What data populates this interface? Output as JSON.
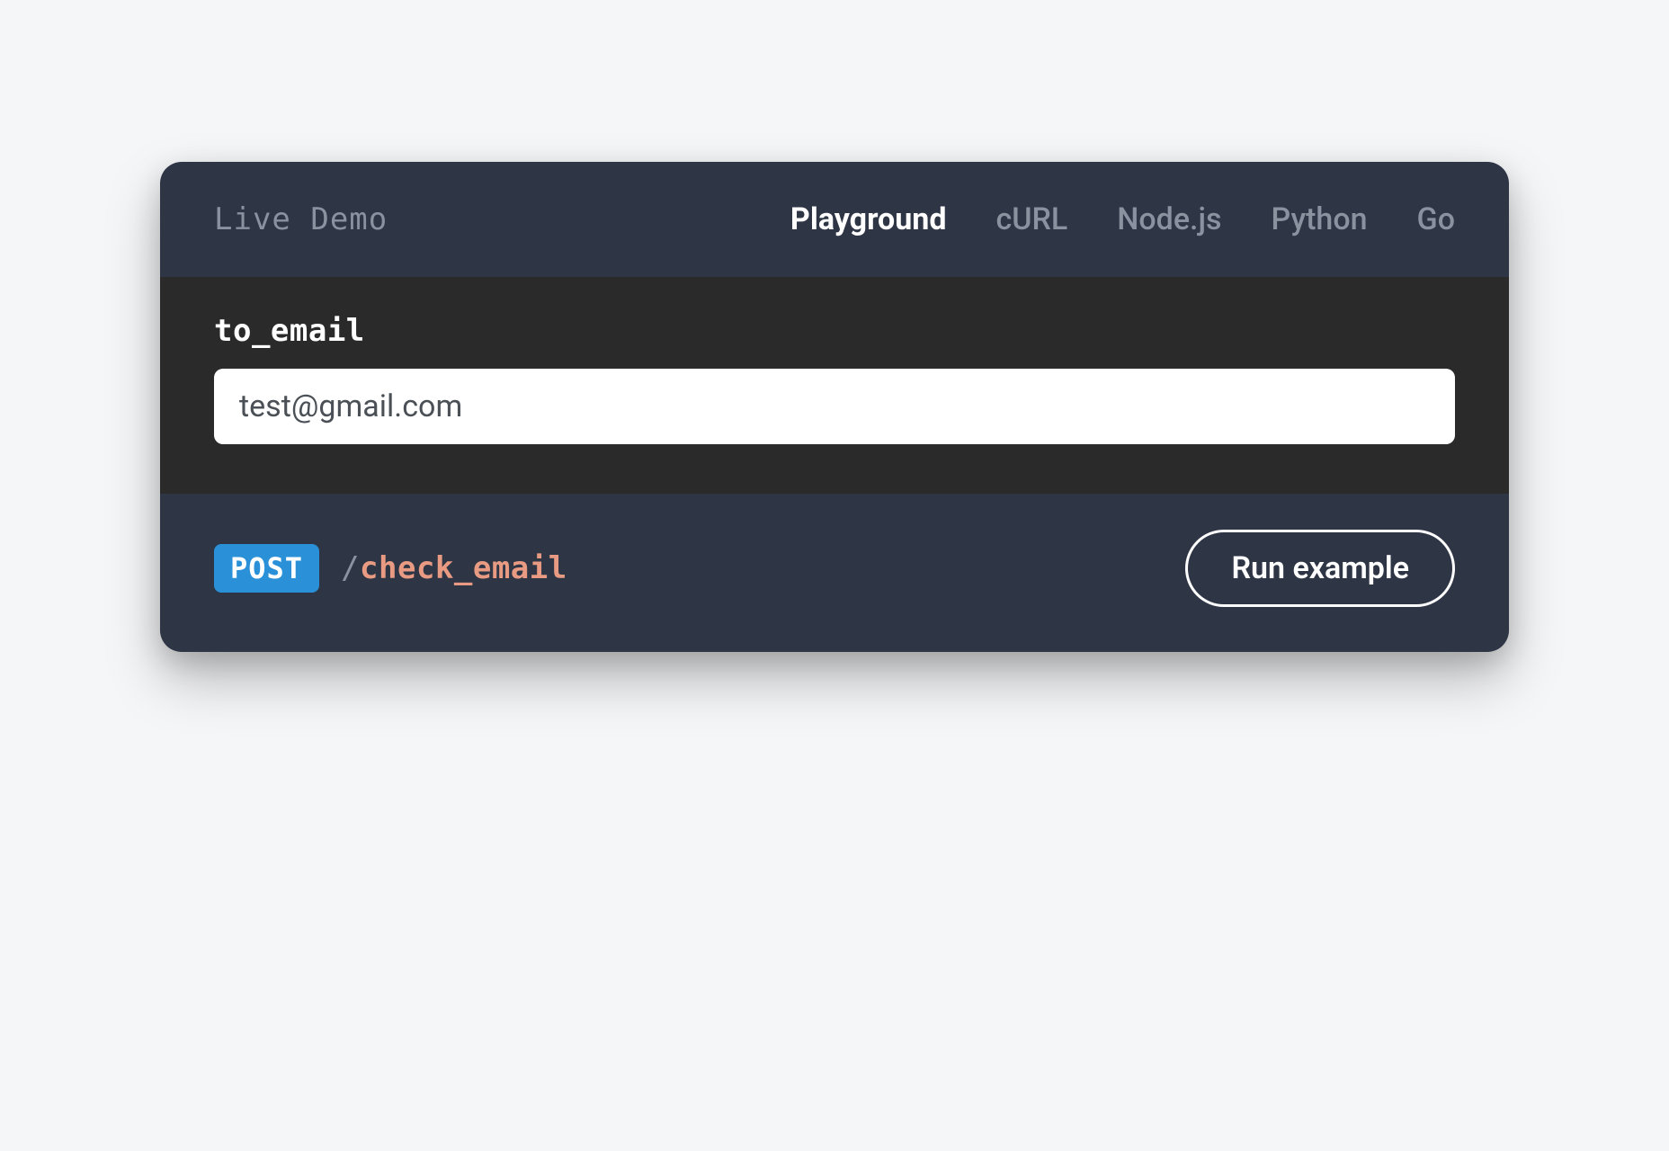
{
  "header": {
    "demo_label": "Live Demo",
    "tabs": [
      {
        "label": "Playground",
        "active": true
      },
      {
        "label": "cURL",
        "active": false
      },
      {
        "label": "Node.js",
        "active": false
      },
      {
        "label": "Python",
        "active": false
      },
      {
        "label": "Go",
        "active": false
      }
    ]
  },
  "form": {
    "field_label": "to_email",
    "email_value": "test@gmail.com"
  },
  "footer": {
    "method": "POST",
    "endpoint_slash": "/",
    "endpoint_path": "check_email",
    "run_button_label": "Run example"
  },
  "colors": {
    "card_bg": "#2e3545",
    "body_bg": "#2a2a2a",
    "method_badge": "#2a90d8",
    "endpoint_path": "#e89b82"
  }
}
